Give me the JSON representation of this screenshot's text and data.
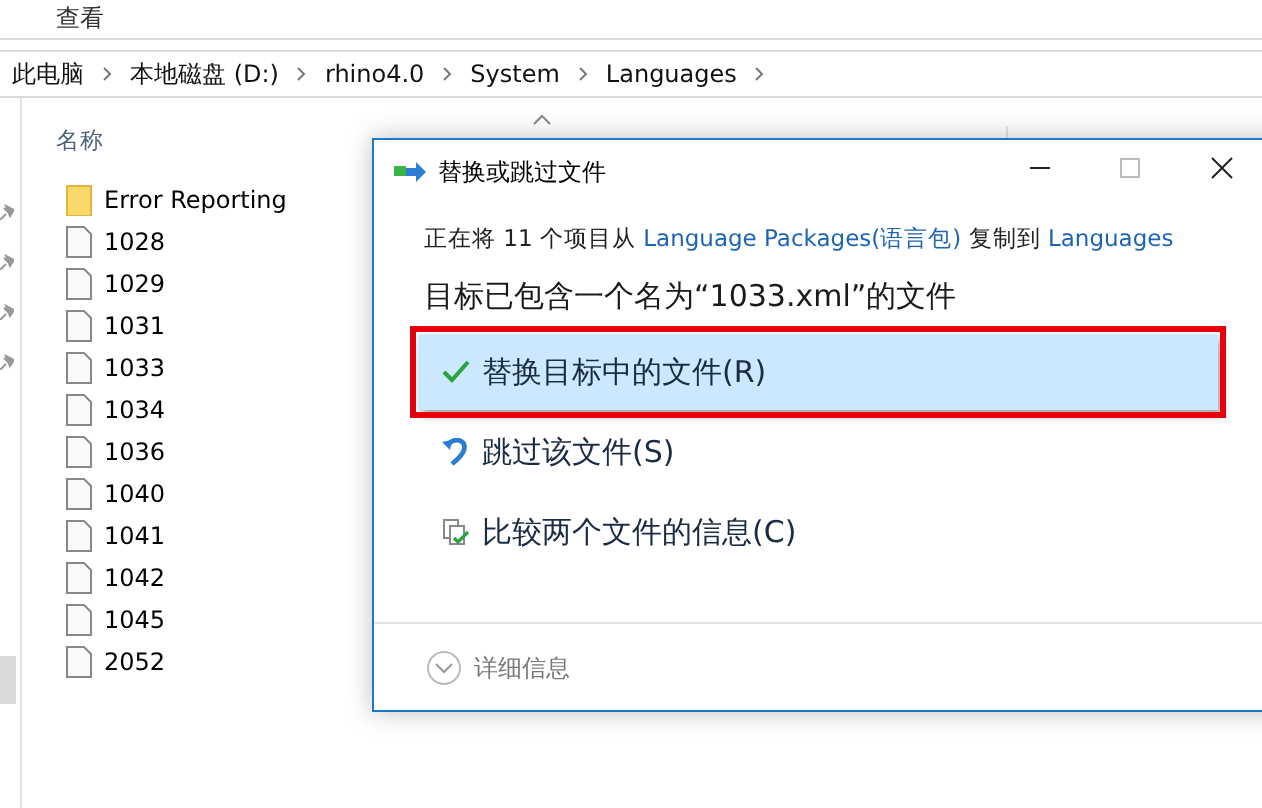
{
  "menu": [
    "查看"
  ],
  "breadcrumb": [
    "此电脑",
    "本地磁盘 (D:)",
    "rhino4.0",
    "System",
    "Languages"
  ],
  "columns": [
    "名称"
  ],
  "files": [
    {
      "name": "Error Reporting",
      "kind": "folder"
    },
    {
      "name": "1028",
      "kind": "file"
    },
    {
      "name": "1029",
      "kind": "file"
    },
    {
      "name": "1031",
      "kind": "file"
    },
    {
      "name": "1033",
      "kind": "file"
    },
    {
      "name": "1034",
      "kind": "file"
    },
    {
      "name": "1036",
      "kind": "file"
    },
    {
      "name": "1040",
      "kind": "file"
    },
    {
      "name": "1041",
      "kind": "file"
    },
    {
      "name": "1042",
      "kind": "file"
    },
    {
      "name": "1045",
      "kind": "file"
    },
    {
      "name": "2052",
      "kind": "file"
    }
  ],
  "dialog": {
    "title": "替换或跳过文件",
    "status": {
      "prefix": "正在将 11 个项目从 ",
      "source": "Language Packages(语言包)",
      "middle": " 复制到 ",
      "target": "Languages"
    },
    "heading": "目标已包含一个名为“1033.xml”的文件",
    "options": [
      {
        "label": "替换目标中的文件(R)",
        "kind": "replace",
        "selected": true
      },
      {
        "label": "跳过该文件(S)",
        "kind": "skip",
        "selected": false
      },
      {
        "label": "比较两个文件的信息(C)",
        "kind": "compare",
        "selected": false
      }
    ],
    "details": "详细信息"
  }
}
